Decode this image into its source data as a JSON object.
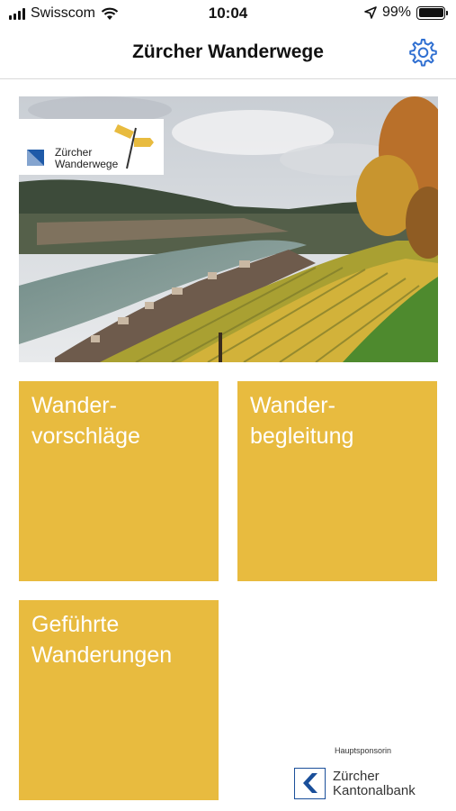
{
  "status_bar": {
    "carrier": "Swisscom",
    "time": "10:04",
    "battery": "99%",
    "icons": [
      "signal-icon",
      "wifi-icon",
      "location-arrow-icon",
      "battery-icon"
    ]
  },
  "nav": {
    "title": "Zürcher Wanderwege",
    "settings_icon": "gear-icon"
  },
  "hero": {
    "logo_line1": "Zürcher",
    "logo_line2": "Wanderwege"
  },
  "tiles": [
    {
      "line1": "Wander-",
      "line2": "vorschläge"
    },
    {
      "line1": "Wander-",
      "line2": "begleitung"
    },
    {
      "line1": "Geführte",
      "line2": "Wanderungen"
    }
  ],
  "sponsor": {
    "label": "Hauptsponsorin",
    "name_line1": "Zürcher",
    "name_line2": "Kantonalbank"
  },
  "colors": {
    "tile": "#e8bb3f",
    "accent_blue": "#2f6fd1",
    "zkb_blue": "#1a4f9a"
  }
}
